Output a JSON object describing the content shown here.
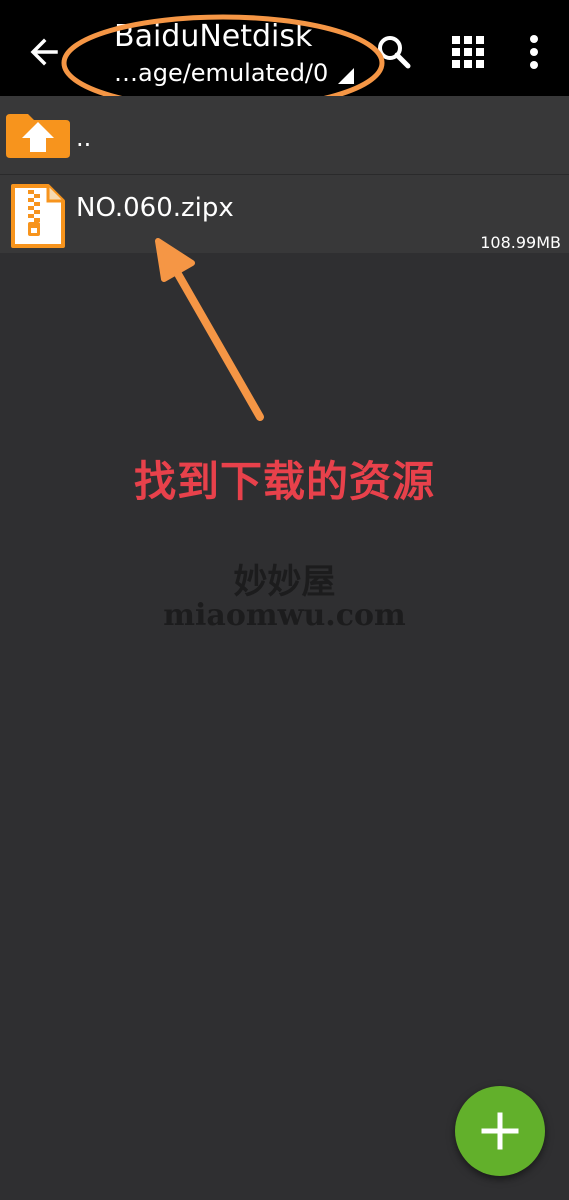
{
  "header": {
    "title": "BaiduNetdisk",
    "path": "…age/emulated/0"
  },
  "icons": {
    "back": "arrow-left-icon",
    "search": "search-icon",
    "grid": "grid-view-icon",
    "more": "more-vertical-icon",
    "fab": "plus-icon"
  },
  "files": [
    {
      "name": "..",
      "type": "parent-folder"
    },
    {
      "name": "NO.060.zipx",
      "size": "108.99MB",
      "type": "zip"
    }
  ],
  "annotation": {
    "text": "找到下载的资源",
    "color": "#e8414b",
    "highlight_color": "#f59645"
  },
  "watermark": {
    "cn": "妙妙屋",
    "en": "miaomwu.com"
  },
  "colors": {
    "background": "#2f2f31",
    "toolbar": "#000000",
    "fab": "#62b02b",
    "folder": "#f7941d"
  }
}
